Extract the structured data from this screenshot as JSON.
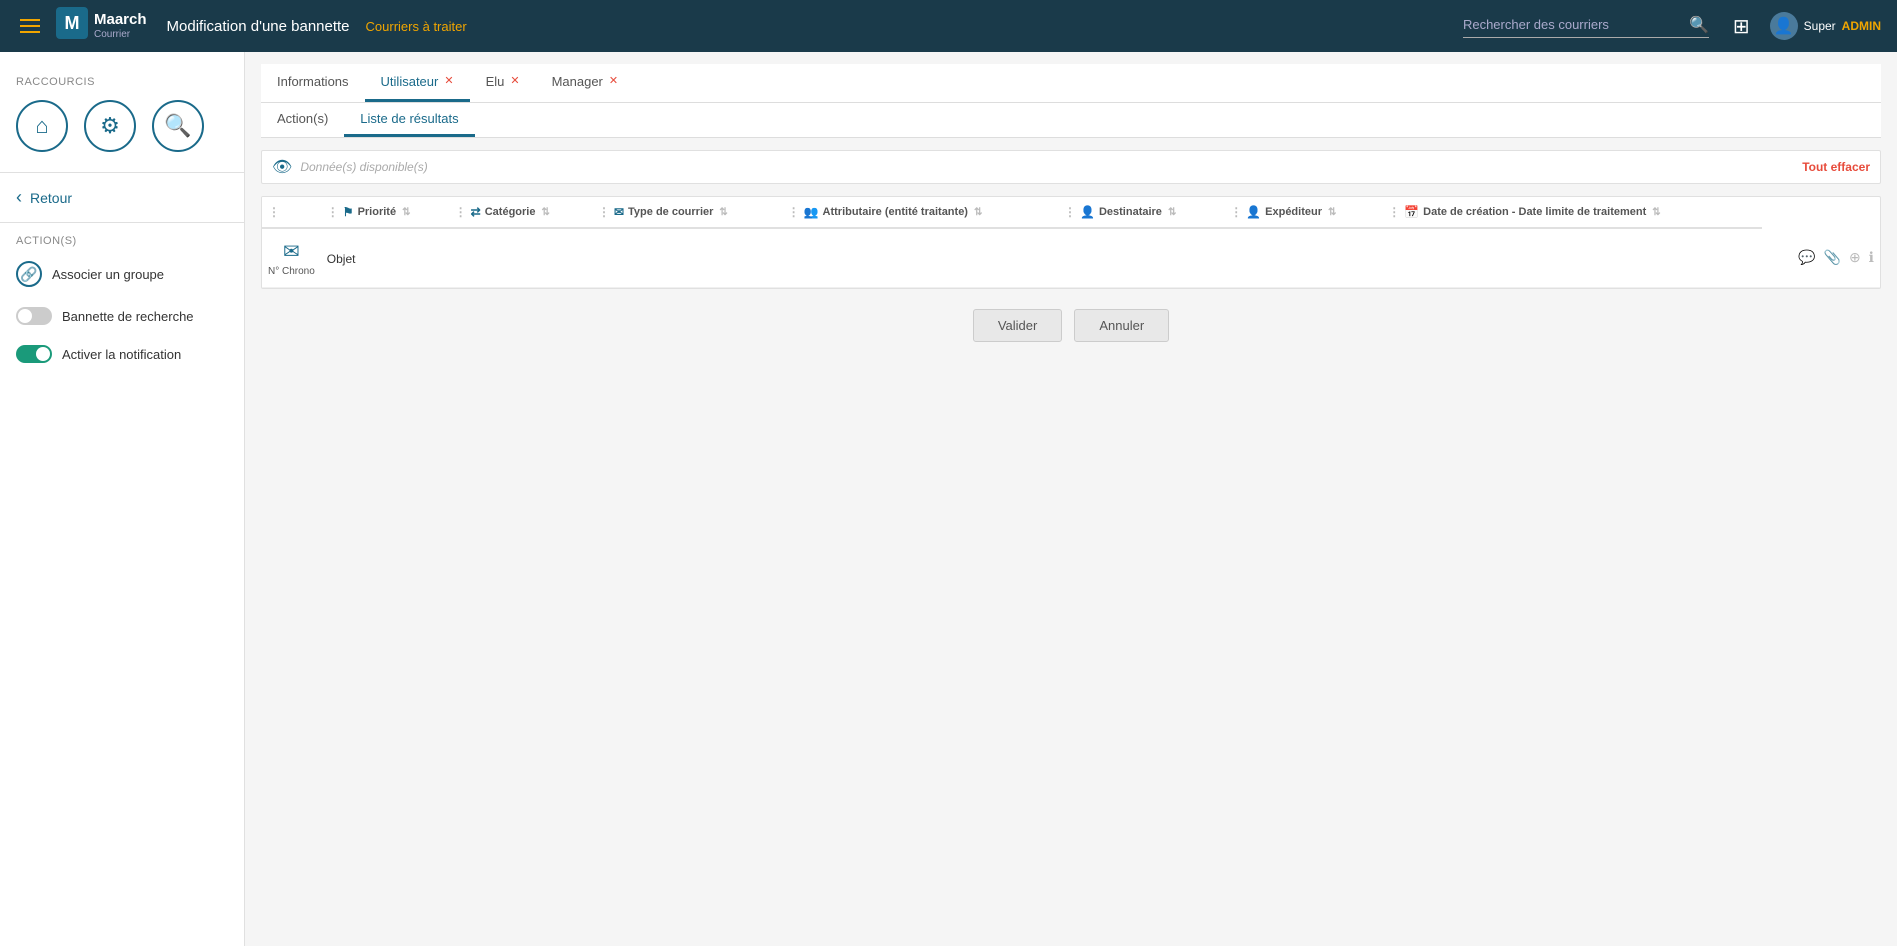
{
  "navbar": {
    "menu_icon": "☰",
    "logo_m": "M",
    "logo_maarch": "Maarch",
    "logo_courrier": "Courrier",
    "title": "Modification d'une bannette",
    "subtitle": "Courriers à traiter",
    "search_placeholder": "Rechercher des courriers",
    "grid_icon": "⊞",
    "user_icon": "👤",
    "user_name": "Super",
    "user_role": "ADMIN"
  },
  "sidebar": {
    "raccourcis_label": "Raccourcis",
    "shortcut_home_icon": "⌂",
    "shortcut_gear_icon": "⚙",
    "shortcut_search_icon": "🔍",
    "back_label": "Retour",
    "actions_label": "Action(s)",
    "associate_group_icon": "🔗",
    "associate_group_label": "Associer un groupe",
    "bannette_recherche_label": "Bannette de recherche",
    "toggle_bannette_state": "off",
    "activate_notification_label": "Activer la notification",
    "toggle_notification_state": "on"
  },
  "tabs": [
    {
      "id": "informations",
      "label": "Informations",
      "closable": false,
      "active": false
    },
    {
      "id": "utilisateur",
      "label": "Utilisateur",
      "closable": true,
      "active": true
    },
    {
      "id": "elu",
      "label": "Elu",
      "closable": true,
      "active": false
    },
    {
      "id": "manager",
      "label": "Manager",
      "closable": true,
      "active": false
    }
  ],
  "sub_tabs": [
    {
      "id": "actions",
      "label": "Action(s)",
      "active": false
    },
    {
      "id": "liste",
      "label": "Liste de résultats",
      "active": true
    }
  ],
  "filter": {
    "eye_icon": "👁",
    "placeholder_text": "Donnée(s) disponible(s)",
    "clear_label": "Tout effacer"
  },
  "table": {
    "columns": [
      {
        "id": "drag",
        "label": ""
      },
      {
        "id": "priorite",
        "label": "Priorité",
        "icon": "flag"
      },
      {
        "id": "categorie",
        "label": "Catégorie",
        "icon": "arrows"
      },
      {
        "id": "type_courrier",
        "label": "Type de courrier",
        "icon": "envelope"
      },
      {
        "id": "attributaire",
        "label": "Attributaire (entité traitante)",
        "icon": "users"
      },
      {
        "id": "destinataire",
        "label": "Destinataire",
        "icon": "user"
      },
      {
        "id": "expediteur",
        "label": "Expéditeur",
        "icon": "user-tie"
      },
      {
        "id": "date",
        "label": "Date de création - Date limite de traitement",
        "icon": "calendar"
      }
    ],
    "chrono_column_label": "N° Chrono",
    "objet_column_label": "Objet",
    "row_mail_icon": "✉",
    "row_icons": [
      "💬",
      "📎",
      "⊕",
      "ℹ"
    ]
  },
  "buttons": {
    "validate_label": "Valider",
    "cancel_label": "Annuler"
  }
}
